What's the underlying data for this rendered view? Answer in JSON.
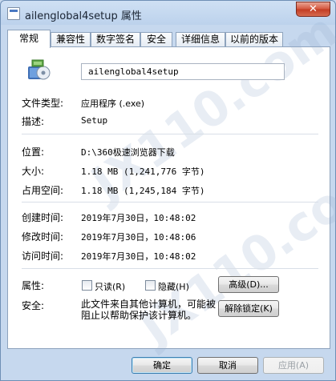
{
  "window": {
    "title": "ailenglobal4setup 属性",
    "close_glyph": "✕"
  },
  "tabs": [
    "常规",
    "兼容性",
    "数字签名",
    "安全",
    "详细信息",
    "以前的版本"
  ],
  "general": {
    "file_name": "ailenglobal4setup",
    "rows": {
      "type_label": "文件类型:",
      "type_value": "应用程序 (.exe)",
      "desc_label": "描述:",
      "desc_value": "Setup",
      "location_label": "位置:",
      "location_value": "D:\\360极速浏览器下载",
      "size_label": "大小:",
      "size_value": "1.18 MB (1,241,776 字节)",
      "disk_size_label": "占用空间:",
      "disk_size_value": "1.18 MB (1,245,184 字节)",
      "created_label": "创建时间:",
      "created_value": "2019年7月30日，10:48:02",
      "modified_label": "修改时间:",
      "modified_value": "2019年7月30日，10:48:06",
      "accessed_label": "访问时间:",
      "accessed_value": "2019年7月30日，10:48:02",
      "attributes_label": "属性:",
      "security_label": "安全:"
    },
    "attributes": {
      "readonly_label": "只读(R)",
      "hidden_label": "隐藏(H)",
      "advanced_button": "高级(D)..."
    },
    "security_text": "此文件来自其他计算机，可能被阻止以帮助保护该计算机。",
    "unblock_button": "解除锁定(K)"
  },
  "footer": {
    "ok": "确定",
    "cancel": "取消",
    "apply": "应用(A)"
  },
  "watermark_text": "JX110.com",
  "colors": {
    "frame": "#c6d8ee",
    "panel": "#ffffff",
    "close": "#c23b22"
  }
}
